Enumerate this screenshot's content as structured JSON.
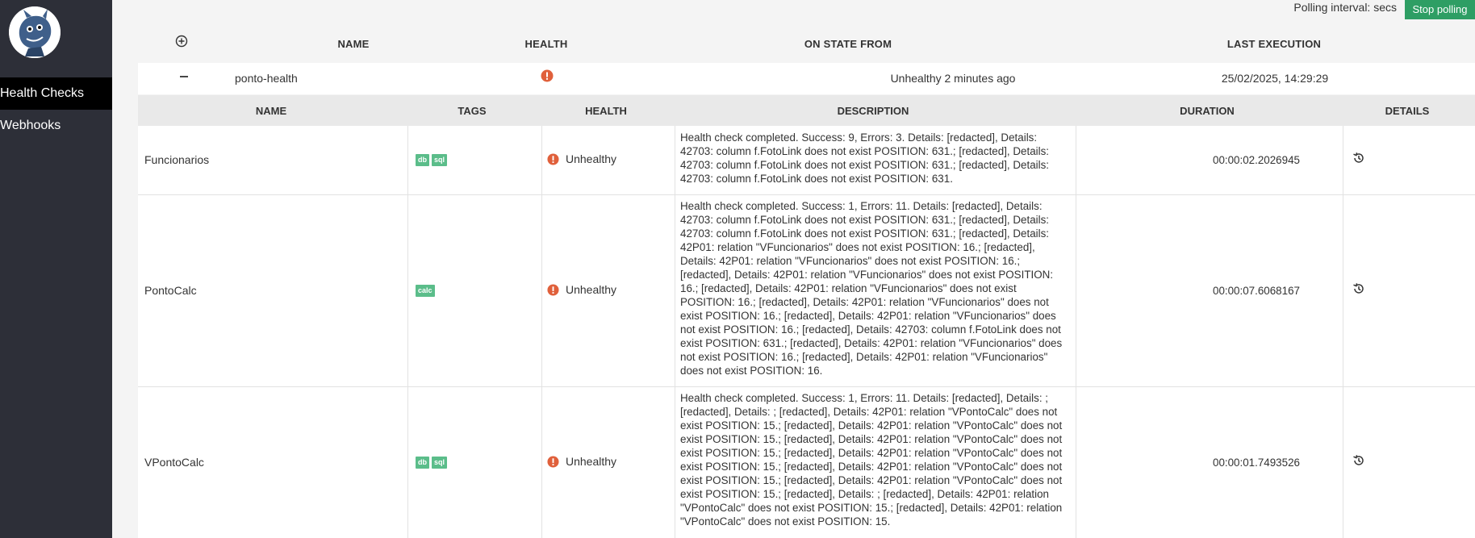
{
  "sidebar": {
    "items": [
      {
        "label": "Health Checks",
        "active": true
      },
      {
        "label": "Webhooks",
        "active": false
      }
    ]
  },
  "topbar": {
    "polling_label": "Polling interval: secs",
    "stop_label": "Stop polling"
  },
  "outer_table": {
    "headers": {
      "name": "NAME",
      "health": "HEALTH",
      "state": "ON STATE FROM",
      "last": "LAST EXECUTION"
    },
    "group": {
      "name": "ponto-health",
      "state_from": "Unhealthy 2 minutes ago",
      "last_execution": "25/02/2025, 14:29:29"
    }
  },
  "inner_table": {
    "headers": {
      "name": "NAME",
      "tags": "TAGS",
      "health": "HEALTH",
      "description": "DESCRIPTION",
      "duration": "DURATION",
      "details": "DETAILS"
    },
    "rows": [
      {
        "name": "Funcionarios",
        "tags": [
          "db",
          "sql"
        ],
        "health": "Unhealthy",
        "description": "Health check completed. Success: 9, Errors: 3. Details: [redacted], Details: 42703: column f.FotoLink does not exist POSITION: 631.; [redacted], Details: 42703: column f.FotoLink does not exist POSITION: 631.; [redacted], Details: 42703: column f.FotoLink does not exist POSITION: 631.",
        "duration": "00:00:02.2026945"
      },
      {
        "name": "PontoCalc",
        "tags": [
          "calc"
        ],
        "health": "Unhealthy",
        "description": "Health check completed. Success: 1, Errors: 11. Details: [redacted], Details: 42703: column f.FotoLink does not exist POSITION: 631.; [redacted], Details: 42703: column f.FotoLink does not exist POSITION: 631.; [redacted], Details: 42P01: relation \"VFuncionarios\" does not exist POSITION: 16.; [redacted], Details: 42P01: relation \"VFuncionarios\" does not exist POSITION: 16.; [redacted], Details: 42P01: relation \"VFuncionarios\" does not exist POSITION: 16.; [redacted], Details: 42P01: relation \"VFuncionarios\" does not exist POSITION: 16.; [redacted], Details: 42P01: relation \"VFuncionarios\" does not exist POSITION: 16.; [redacted], Details: 42P01: relation \"VFuncionarios\" does not exist POSITION: 16.; [redacted], Details: 42703: column f.FotoLink does not exist POSITION: 631.; [redacted], Details: 42P01: relation \"VFuncionarios\" does not exist POSITION: 16.; [redacted], Details: 42P01: relation \"VFuncionarios\" does not exist POSITION: 16.",
        "duration": "00:00:07.6068167"
      },
      {
        "name": "VPontoCalc",
        "tags": [
          "db",
          "sql"
        ],
        "health": "Unhealthy",
        "description": "Health check completed. Success: 1, Errors: 11. Details: [redacted], Details: ; [redacted], Details: ; [redacted], Details: 42P01: relation \"VPontoCalc\" does not exist POSITION: 15.; [redacted], Details: 42P01: relation \"VPontoCalc\" does not exist POSITION: 15.; [redacted], Details: 42P01: relation \"VPontoCalc\" does not exist POSITION: 15.; [redacted], Details: 42P01: relation \"VPontoCalc\" does not exist POSITION: 15.; [redacted], Details: 42P01: relation \"VPontoCalc\" does not exist POSITION: 15.; [redacted], Details: 42P01: relation \"VPontoCalc\" does not exist POSITION: 15.; [redacted], Details: ; [redacted], Details: 42P01: relation \"VPontoCalc\" does not exist POSITION: 15.; [redacted], Details: 42P01: relation \"VPontoCalc\" does not exist POSITION: 15.",
        "duration": "00:00:01.7493526"
      }
    ]
  },
  "colors": {
    "sidebar_bg": "#2d2f38",
    "active_nav": "#000000",
    "stop_button": "#2e9e64",
    "tag": "#5bbd8a",
    "unhealthy": "#e0603b"
  },
  "icons": {
    "add": "add-circle-icon",
    "collapse": "minus-icon",
    "error": "error-circle-icon",
    "history": "history-icon"
  }
}
